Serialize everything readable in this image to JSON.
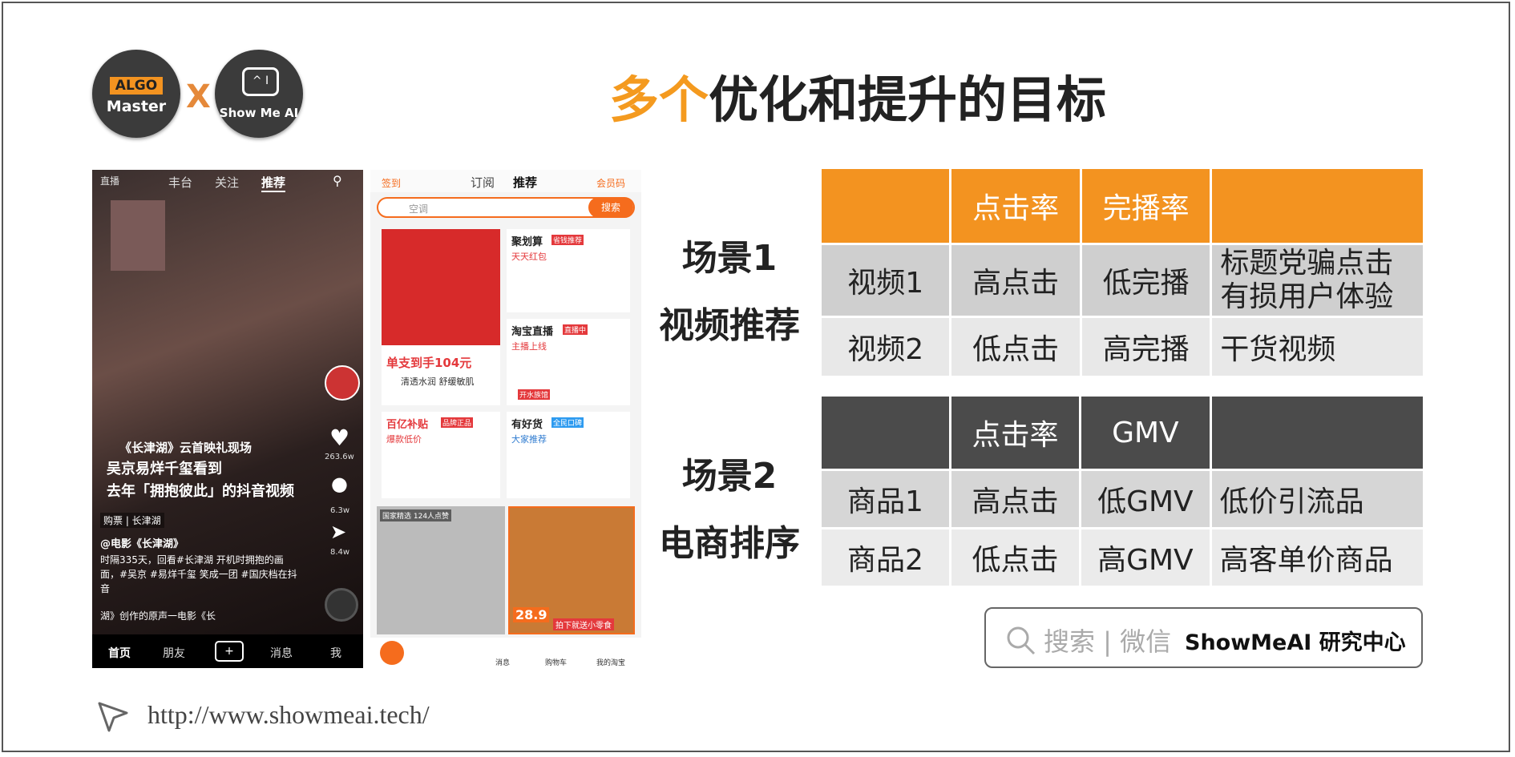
{
  "logos": {
    "algo_top": "ALGO",
    "algo_bottom": "Master",
    "cross": "X",
    "showme": "Show Me AI"
  },
  "title": {
    "highlight": "多个",
    "rest": "优化和提升的目标"
  },
  "phone1": {
    "tabs": [
      "直播",
      "丰台",
      "关注",
      "推荐"
    ],
    "caption_top": "《长津湖》云首映礼现场",
    "caption_main": "吴京易烊千玺看到\n去年「拥抱彼此」的抖音视频",
    "purchase": "购票 | 长津湖",
    "author": "@电影《长津湖》",
    "desc": "时隔335天，回看#长津湖 开机时拥抱的画面，#吴京 #易烊千玺 笑成一团 #国庆档在抖音",
    "music": "湖》创作的原声一电影《长",
    "likes": "263.6w",
    "comments": "6.3w",
    "shares": "8.4w",
    "nav": [
      "首页",
      "朋友",
      "+",
      "消息",
      "我"
    ]
  },
  "phone2": {
    "top_left": "签到",
    "tabs": [
      "订阅",
      "推荐"
    ],
    "top_right": "会员码",
    "search_placeholder": "空调",
    "search_button": "搜索",
    "card1_price": "单支到手104元",
    "card1_sub": "清透水润 舒缓敏肌",
    "card2_title": "聚划算",
    "card2_badge": "省钱推荐",
    "card2_sub": "天天红包",
    "card3_title": "淘宝直播",
    "card3_badge": "直播中",
    "card3_sub": "主播上线",
    "card3_name": "开水族馆",
    "card4_title": "百亿补贴",
    "card4_badge": "品牌正品",
    "card4_sub": "爆款低价",
    "card5_title": "有好货",
    "card5_badge": "全民口碑",
    "card5_sub": "大家推荐",
    "card6_tag": "国家精选 124人点赞",
    "card7_price": "28.9",
    "card7_sub": "拍下就送小零食",
    "nav": [
      "消息",
      "购物车",
      "我的淘宝"
    ]
  },
  "scene1": {
    "line1": "场景1",
    "line2": "视频推荐"
  },
  "scene2": {
    "line1": "场景2",
    "line2": "电商排序"
  },
  "table1": {
    "header": [
      "",
      "点击率",
      "完播率",
      ""
    ],
    "rows": [
      [
        "视频1",
        "高点击",
        "低完播",
        "标题党骗点击\n有损用户体验"
      ],
      [
        "视频2",
        "低点击",
        "高完播",
        "干货视频"
      ]
    ]
  },
  "table2": {
    "header": [
      "",
      "点击率",
      "GMV",
      ""
    ],
    "rows": [
      [
        "商品1",
        "高点击",
        "低GMV",
        "低价引流品"
      ],
      [
        "商品2",
        "低点击",
        "高GMV",
        "高客单价商品"
      ]
    ]
  },
  "search": {
    "left": "搜索 | 微信",
    "right": "ShowMeAI 研究中心"
  },
  "footer": {
    "url": "http://www.showmeai.tech/"
  },
  "colors": {
    "accent": "#f39320",
    "dark_header": "#4b4b4b"
  },
  "icons": [
    "search-icon",
    "cursor-icon"
  ]
}
